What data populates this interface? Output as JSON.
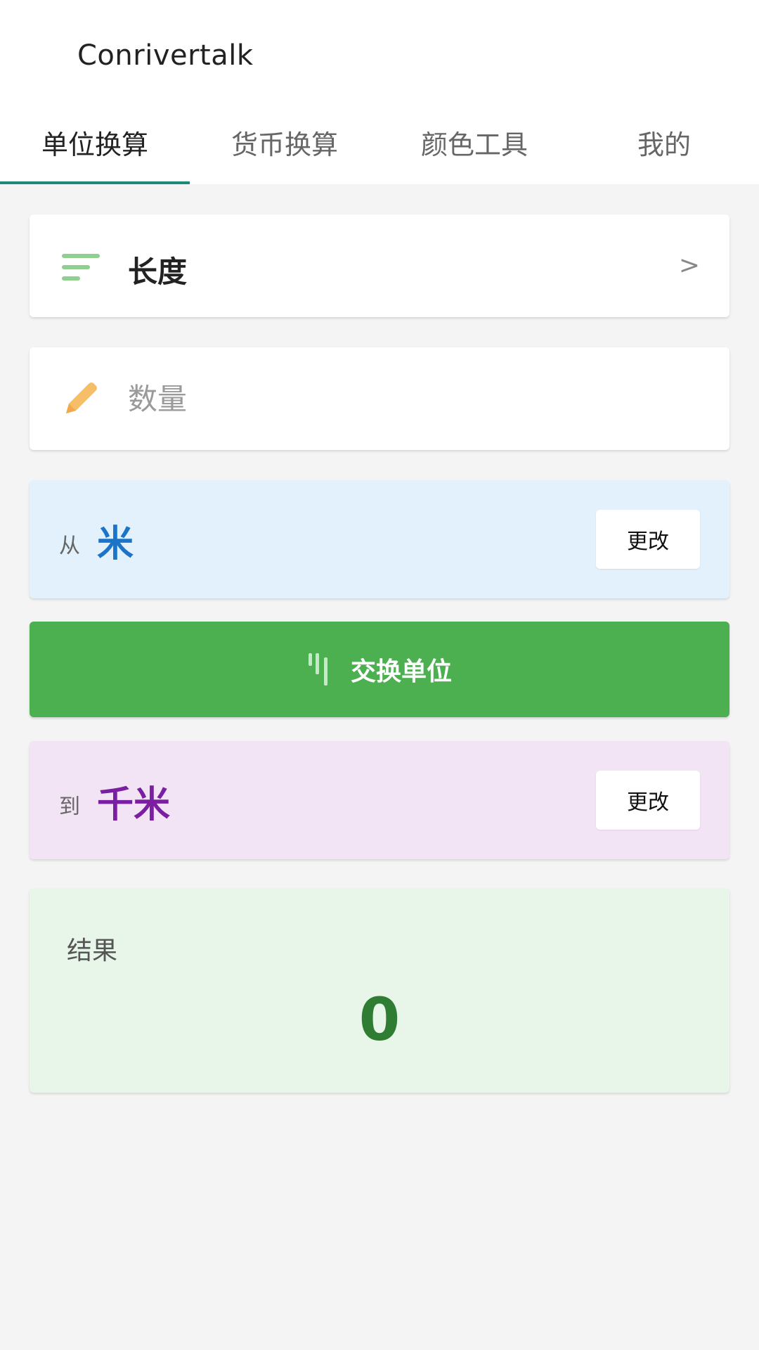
{
  "app": {
    "title": "Conrivertalk"
  },
  "tabs": [
    {
      "label": "单位换算",
      "active": true
    },
    {
      "label": "货币换算",
      "active": false
    },
    {
      "label": "颜色工具",
      "active": false
    },
    {
      "label": "我的",
      "active": false
    }
  ],
  "category": {
    "icon": "sort-icon",
    "label": "长度",
    "chevron": ">"
  },
  "quantity": {
    "icon": "pencil-icon",
    "value": "",
    "placeholder": "数量"
  },
  "from_unit": {
    "prefix": "从",
    "name": "米",
    "change_label": "更改"
  },
  "swap": {
    "icon": "swap-icon",
    "label": "交换单位"
  },
  "to_unit": {
    "prefix": "到",
    "name": "千米",
    "change_label": "更改"
  },
  "result": {
    "label": "结果",
    "value": "0"
  },
  "colors": {
    "tab_indicator": "#1a8a7a",
    "swap_button": "#4caf50",
    "from_bg": "#e3f1fc",
    "from_unit_text": "#1c74c9",
    "to_bg": "#f3e4f5",
    "to_unit_text": "#7b1fa2",
    "result_bg": "#e8f5e9",
    "result_text": "#2e7d32"
  }
}
